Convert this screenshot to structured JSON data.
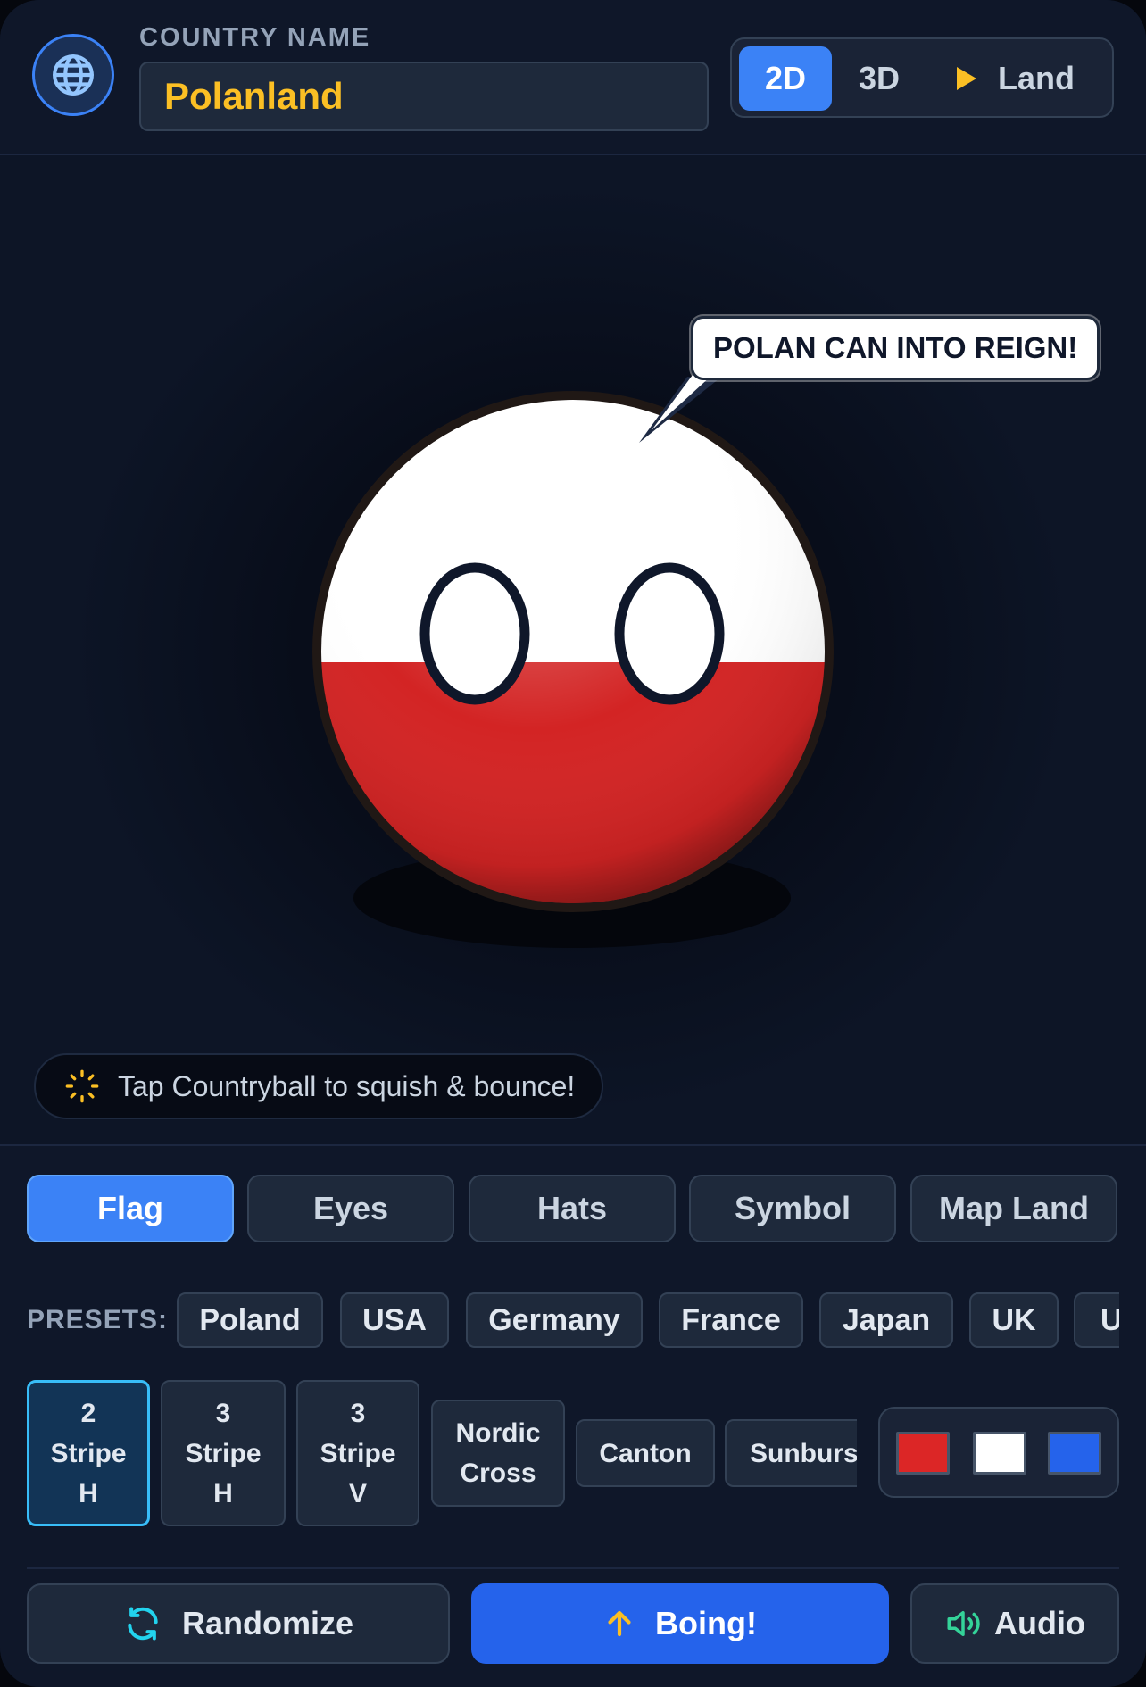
{
  "header": {
    "name_label": "COUNTRY NAME",
    "name_value": "Polanland",
    "modes": {
      "two_d": "2D",
      "three_d": "3D",
      "land": "Land"
    },
    "active_mode": "2D"
  },
  "stage": {
    "speech": "POLAN CAN INTO REIGN!",
    "hint": "Tap Countryball to squish & bounce!"
  },
  "tabs": [
    "Flag",
    "Eyes",
    "Hats",
    "Symbol",
    "Map Land"
  ],
  "active_tab": "Flag",
  "presets": {
    "label": "PRESETS:",
    "items": [
      "Poland",
      "USA",
      "Germany",
      "France",
      "Japan",
      "UK",
      "U"
    ]
  },
  "patterns": {
    "items": [
      {
        "lines": [
          "2",
          "Stripe",
          "H"
        ]
      },
      {
        "lines": [
          "3",
          "Stripe",
          "H"
        ]
      },
      {
        "lines": [
          "3",
          "Stripe",
          "V"
        ]
      },
      {
        "lines": [
          "Nordic",
          "Cross"
        ]
      },
      {
        "lines": [
          "Canton"
        ]
      },
      {
        "lines": [
          "Sunburs"
        ]
      }
    ],
    "active_index": 0
  },
  "colors": [
    "#dc2626",
    "#ffffff",
    "#2563eb"
  ],
  "actions": {
    "randomize": "Randomize",
    "boing": "Boing!",
    "audio": "Audio"
  },
  "theme": {
    "accent": "#3b82f6",
    "name_color": "#fbbf24",
    "flag_top": "#ffffff",
    "flag_bottom": "#d32424"
  },
  "icons": {
    "globe": "globe-icon",
    "play": "play-icon",
    "sparkle": "sparkle-icon",
    "refresh": "refresh-icon",
    "arrow_up": "arrow-up-icon",
    "speaker": "speaker-icon"
  }
}
